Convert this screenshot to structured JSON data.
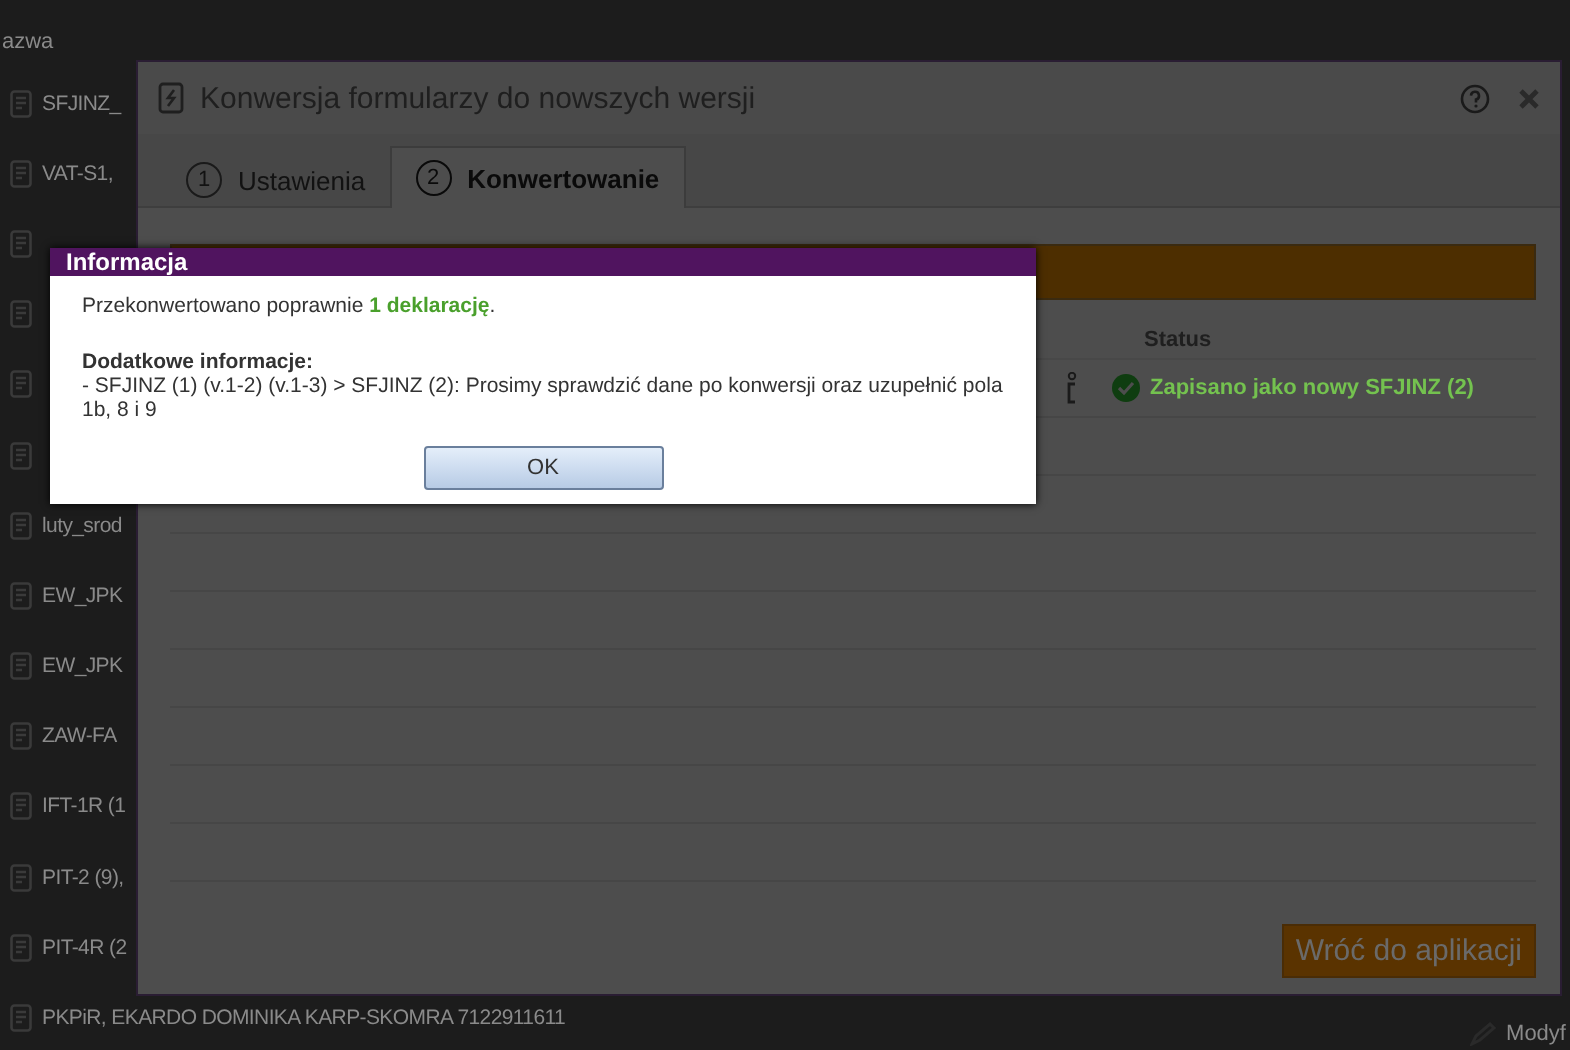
{
  "list": {
    "header": "azwa",
    "items": [
      {
        "kind": "document",
        "label": "SFJINZ_"
      },
      {
        "kind": "document",
        "label": "VAT-S1,"
      },
      {
        "kind": "document"
      },
      {
        "kind": "document"
      },
      {
        "kind": "document"
      },
      {
        "kind": "document"
      },
      {
        "kind": "document",
        "label": "luty_srod"
      },
      {
        "kind": "document",
        "label": "EW_JPK"
      },
      {
        "kind": "document",
        "label": "EW_JPK"
      },
      {
        "kind": "document",
        "label": "ZAW-FA"
      },
      {
        "kind": "document",
        "label": "IFT-1R (1"
      },
      {
        "kind": "document",
        "label": "PIT-2 (9),"
      },
      {
        "kind": "document",
        "label": "PIT-4R (2"
      },
      {
        "kind": "document",
        "label": "PKPiR, EKARDO DOMINIKA KARP-SKOMRA 7122911611"
      }
    ],
    "modify": "Modyf"
  },
  "window": {
    "title": "Konwersja formularzy do nowszych wersji",
    "tabs": [
      {
        "number": "1",
        "label": "Ustawienia",
        "selected": false
      },
      {
        "number": "2",
        "label": "Konwertowanie",
        "selected": true
      }
    ],
    "progress": {
      "level": 1
    },
    "table": {
      "columns": [
        "Status"
      ],
      "rows": [
        {
          "status": "Zapisano jako nowy SFJINZ (2)",
          "ok": true
        }
      ]
    },
    "back_button": "Wróć do aplikacji"
  },
  "dialog": {
    "title": "Informacja",
    "message_prefix": "Przekonwertowano poprawnie ",
    "message_highlight": "1 deklarację",
    "message_suffix": ".",
    "details_title": "Dodatkowe informacje:",
    "details": "- SFJINZ (1) (v.1-2) (v.1-3) > SFJINZ (2): Prosimy sprawdzić dane po konwersji oraz uzupełnić pola 1b, 8 i 9",
    "ok_button": "OK"
  }
}
